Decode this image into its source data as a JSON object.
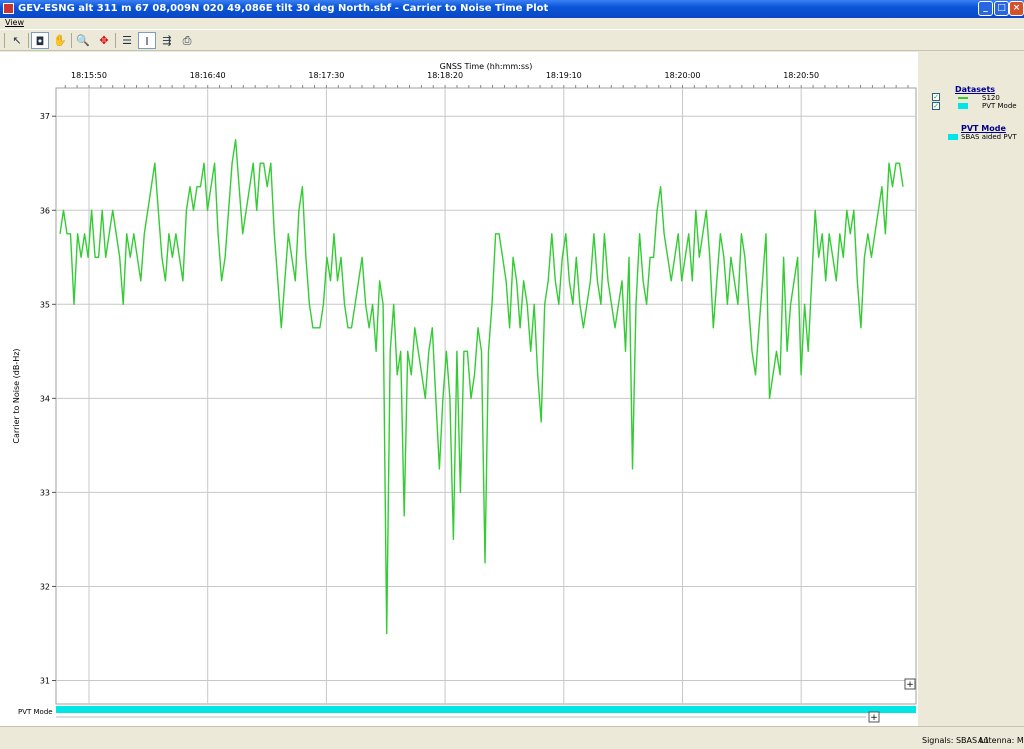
{
  "window": {
    "title": "GEV-ESNG alt 311 m 67 08,009N 020 49,086E tilt 30 deg North.sbf - Carrier to Noise Time Plot",
    "minimize": "_",
    "maximize": "□",
    "close": "×"
  },
  "menu": {
    "view": "View"
  },
  "toolbar": {
    "buttons": [
      {
        "name": "pointer-icon",
        "glyph": "↖"
      },
      {
        "name": "select-icon",
        "glyph": "◘"
      },
      {
        "name": "pan-hand-icon",
        "glyph": "✋"
      },
      {
        "name": "zoom-icon",
        "glyph": "🔍"
      },
      {
        "name": "zoom-fit-icon",
        "glyph": "✥"
      },
      {
        "name": "horizontal-lines-icon",
        "glyph": "☰"
      },
      {
        "name": "vertical-range-icon",
        "glyph": "Ⅰ"
      },
      {
        "name": "signal-icon",
        "glyph": "⇶"
      },
      {
        "name": "print-icon",
        "glyph": "⎙"
      }
    ]
  },
  "colors": {
    "series": "#33cc33",
    "pvt": "#00e5e5",
    "grid": "#c8c8c8"
  },
  "legend": {
    "datasets_title": "Datasets",
    "datasets": [
      {
        "label": "S120",
        "checked": true
      },
      {
        "label": "PVT Mode",
        "checked": true
      }
    ],
    "pvt_title": "PVT Mode",
    "pvt_items": [
      "SBAS aided PVT"
    ]
  },
  "status": {
    "signals": "Signals: SBAS L1",
    "antenna": "Antenna: Main"
  },
  "chart_data": {
    "type": "line",
    "xlabel": "GNSS Time (hh:mm:ss)",
    "ylabel": "Carrier to Noise (dB-Hz)",
    "x_tick_labels": [
      "18:15:50",
      "18:16:40",
      "18:17:30",
      "18:18:20",
      "18:19:10",
      "18:20:00",
      "18:20:50"
    ],
    "y_ticks": [
      31,
      32,
      33,
      34,
      35,
      36,
      37
    ],
    "ylim": [
      30.75,
      37.3
    ],
    "grid": true,
    "lower_panel_label": "PVT Mode",
    "series": [
      {
        "name": "S120",
        "values": [
          35.75,
          36,
          35.75,
          35.75,
          35,
          35.75,
          35.5,
          35.75,
          35.5,
          36,
          35.5,
          35.5,
          36,
          35.5,
          35.75,
          36,
          35.75,
          35.5,
          35,
          35.75,
          35.5,
          35.75,
          35.5,
          35.25,
          35.75,
          36,
          36.25,
          36.5,
          36,
          35.5,
          35.25,
          35.75,
          35.5,
          35.75,
          35.5,
          35.25,
          36,
          36.25,
          36,
          36.25,
          36.25,
          36.5,
          36,
          36.25,
          36.5,
          35.75,
          35.25,
          35.5,
          36,
          36.5,
          36.75,
          36.25,
          35.75,
          36,
          36.25,
          36.5,
          36,
          36.5,
          36.5,
          36.25,
          36.5,
          35.75,
          35.25,
          34.75,
          35.25,
          35.75,
          35.5,
          35.25,
          36,
          36.25,
          35.5,
          35,
          34.75,
          34.75,
          34.75,
          35,
          35.5,
          35.25,
          35.75,
          35.25,
          35.5,
          35,
          34.75,
          34.75,
          35,
          35.25,
          35.5,
          35,
          34.75,
          35,
          34.5,
          35.25,
          35,
          31.5,
          34.5,
          35,
          34.25,
          34.5,
          32.75,
          34.5,
          34.25,
          34.75,
          34.5,
          34.25,
          34,
          34.5,
          34.75,
          34,
          33.25,
          34,
          34.5,
          34,
          32.5,
          34.5,
          33,
          34.5,
          34.5,
          34,
          34.25,
          34.75,
          34.5,
          32.25,
          34.5,
          35,
          35.75,
          35.75,
          35.5,
          35.25,
          34.75,
          35.5,
          35.25,
          34.75,
          35.25,
          35,
          34.5,
          35,
          34.25,
          33.75,
          35,
          35.25,
          35.75,
          35.25,
          35,
          35.5,
          35.75,
          35.25,
          35,
          35.5,
          35,
          34.75,
          35,
          35.25,
          35.75,
          35.25,
          35,
          35.75,
          35.25,
          35,
          34.75,
          35,
          35.25,
          34.5,
          35.5,
          33.25,
          35,
          35.75,
          35.25,
          35,
          35.5,
          35.5,
          36,
          36.25,
          35.75,
          35.5,
          35.25,
          35.5,
          35.75,
          35.25,
          35.5,
          35.75,
          35.25,
          36,
          35.5,
          35.75,
          36,
          35.5,
          34.75,
          35.25,
          35.75,
          35.5,
          35,
          35.5,
          35.25,
          35,
          35.75,
          35.5,
          35,
          34.5,
          34.25,
          34.75,
          35.25,
          35.75,
          34,
          34.25,
          34.5,
          34.25,
          35.5,
          34.5,
          35,
          35.25,
          35.5,
          34.25,
          35,
          34.5,
          35.25,
          36,
          35.5,
          35.75,
          35.25,
          35.75,
          35.5,
          35.25,
          35.75,
          35.5,
          36,
          35.75,
          36,
          35.25,
          34.75,
          35.5,
          35.75,
          35.5,
          35.75,
          36,
          36.25,
          35.75,
          36.5,
          36.25,
          36.5,
          36.5,
          36.25
        ]
      }
    ]
  }
}
